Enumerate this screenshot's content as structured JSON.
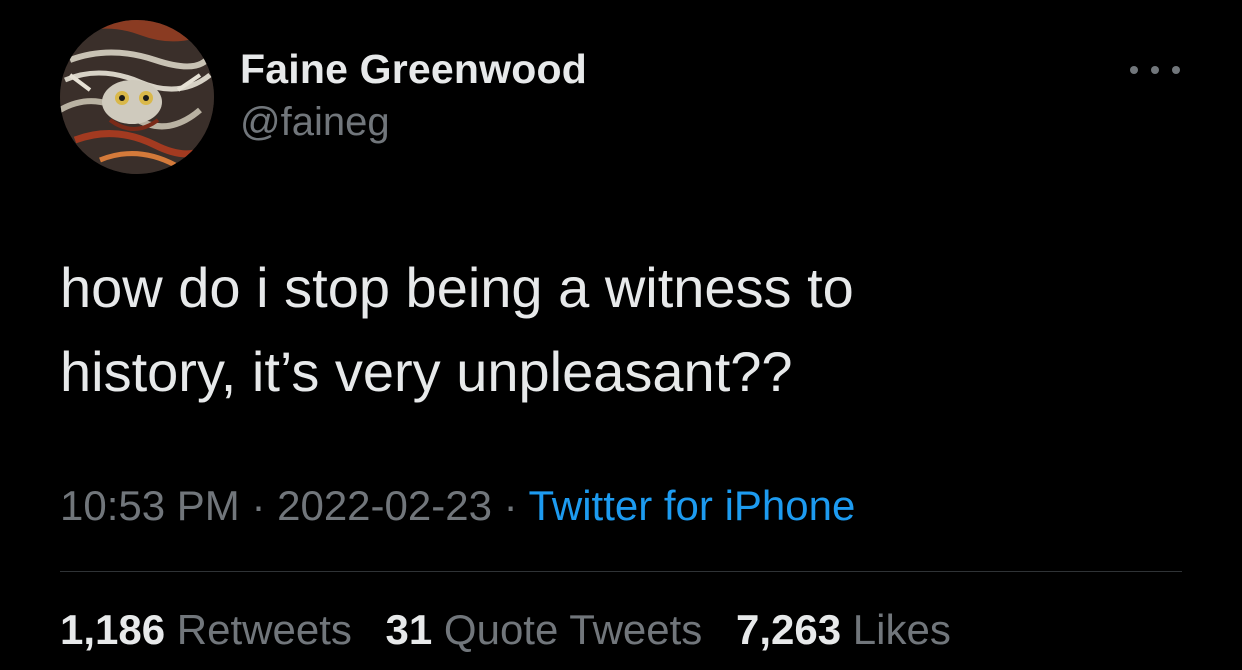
{
  "tweet": {
    "author": {
      "display_name": "Faine Greenwood",
      "handle": "@faineg",
      "avatar_icon": "dragon-artwork-avatar"
    },
    "more_icon": "ellipsis-icon",
    "text_lines": [
      "how do i stop being a witness to",
      "history, it’s very unpleasant??"
    ],
    "time": "10:53 PM",
    "separator": " · ",
    "date": "2022-02-23",
    "source": "Twitter for iPhone",
    "stats": {
      "retweets": {
        "count": "1,186",
        "label": "Retweets"
      },
      "quote_tweets": {
        "count": "31",
        "label": "Quote Tweets"
      },
      "likes": {
        "count": "7,263",
        "label": "Likes"
      }
    }
  },
  "colors": {
    "background": "#000000",
    "primary_text": "#e7e9ea",
    "secondary_text": "#71767b",
    "link": "#1d9bf0",
    "divider": "#2f3336"
  }
}
